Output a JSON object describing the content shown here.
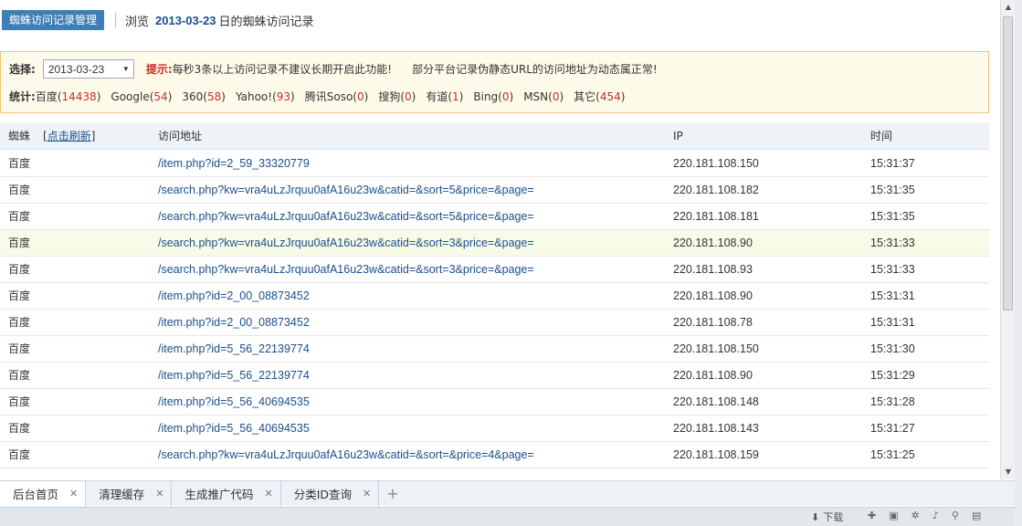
{
  "header": {
    "tab_label": "蜘蛛访问记录管理",
    "browse_prefix": "浏览",
    "date": "2013-03-23",
    "browse_suffix": "日的蜘蛛访问记录"
  },
  "filter": {
    "select_label": "选择:",
    "selected_date": "2013-03-23",
    "tip_label": "提示:",
    "tip_text": "每秒3条以上访问记录不建议长期开启此功能!",
    "tip_text2": "部分平台记录伪静态URL的访问地址为动态属正常!",
    "stats_label": "统计:",
    "stats": [
      {
        "name": "百度",
        "count": "14438"
      },
      {
        "name": "Google",
        "count": "54"
      },
      {
        "name": "360",
        "count": "58"
      },
      {
        "name": "Yahoo!",
        "count": "93"
      },
      {
        "name": "腾讯Soso",
        "count": "0"
      },
      {
        "name": "搜狗",
        "count": "0"
      },
      {
        "name": "有道",
        "count": "1"
      },
      {
        "name": "Bing",
        "count": "0"
      },
      {
        "name": "MSN",
        "count": "0"
      },
      {
        "name": "其它",
        "count": "454"
      }
    ]
  },
  "table": {
    "col_spider": "蜘蛛",
    "refresh_label": "点击刷新",
    "col_url": "访问地址",
    "col_ip": "IP",
    "col_time": "时间",
    "rows": [
      {
        "spider": "百度",
        "url": "/item.php?id=2_59_33320779",
        "ip": "220.181.108.150",
        "time": "15:31:37"
      },
      {
        "spider": "百度",
        "url": "/search.php?kw=vra4uLzJrquu0afA16u23w&catid=&sort=5&price=&page=",
        "ip": "220.181.108.182",
        "time": "15:31:35"
      },
      {
        "spider": "百度",
        "url": "/search.php?kw=vra4uLzJrquu0afA16u23w&catid=&sort=5&price=&page=",
        "ip": "220.181.108.181",
        "time": "15:31:35"
      },
      {
        "spider": "百度",
        "url": "/search.php?kw=vra4uLzJrquu0afA16u23w&catid=&sort=3&price=&page=",
        "ip": "220.181.108.90",
        "time": "15:31:33"
      },
      {
        "spider": "百度",
        "url": "/search.php?kw=vra4uLzJrquu0afA16u23w&catid=&sort=3&price=&page=",
        "ip": "220.181.108.93",
        "time": "15:31:33"
      },
      {
        "spider": "百度",
        "url": "/item.php?id=2_00_08873452",
        "ip": "220.181.108.90",
        "time": "15:31:31"
      },
      {
        "spider": "百度",
        "url": "/item.php?id=2_00_08873452",
        "ip": "220.181.108.78",
        "time": "15:31:31"
      },
      {
        "spider": "百度",
        "url": "/item.php?id=5_56_22139774",
        "ip": "220.181.108.150",
        "time": "15:31:30"
      },
      {
        "spider": "百度",
        "url": "/item.php?id=5_56_22139774",
        "ip": "220.181.108.90",
        "time": "15:31:29"
      },
      {
        "spider": "百度",
        "url": "/item.php?id=5_56_40694535",
        "ip": "220.181.108.148",
        "time": "15:31:28"
      },
      {
        "spider": "百度",
        "url": "/item.php?id=5_56_40694535",
        "ip": "220.181.108.143",
        "time": "15:31:27"
      },
      {
        "spider": "百度",
        "url": "/search.php?kw=vra4uLzJrquu0afA16u23w&catid=&sort=&price=4&page=",
        "ip": "220.181.108.159",
        "time": "15:31:25"
      }
    ]
  },
  "tabs": [
    {
      "label": "后台首页"
    },
    {
      "label": "清理缓存"
    },
    {
      "label": "生成推广代码"
    },
    {
      "label": "分类ID查询"
    }
  ],
  "statusbar": {
    "download_label": "下载"
  },
  "colors": {
    "accent": "#3f7fb8",
    "link": "#1b4f8a",
    "highlight_num": "#c62d2d",
    "notice_bg": "#fffbea",
    "notice_border": "#f0c27a"
  },
  "icons": {
    "tab_close": "close-icon",
    "tab_add": "plus-icon",
    "select_arrow": "chevron-down-icon"
  }
}
